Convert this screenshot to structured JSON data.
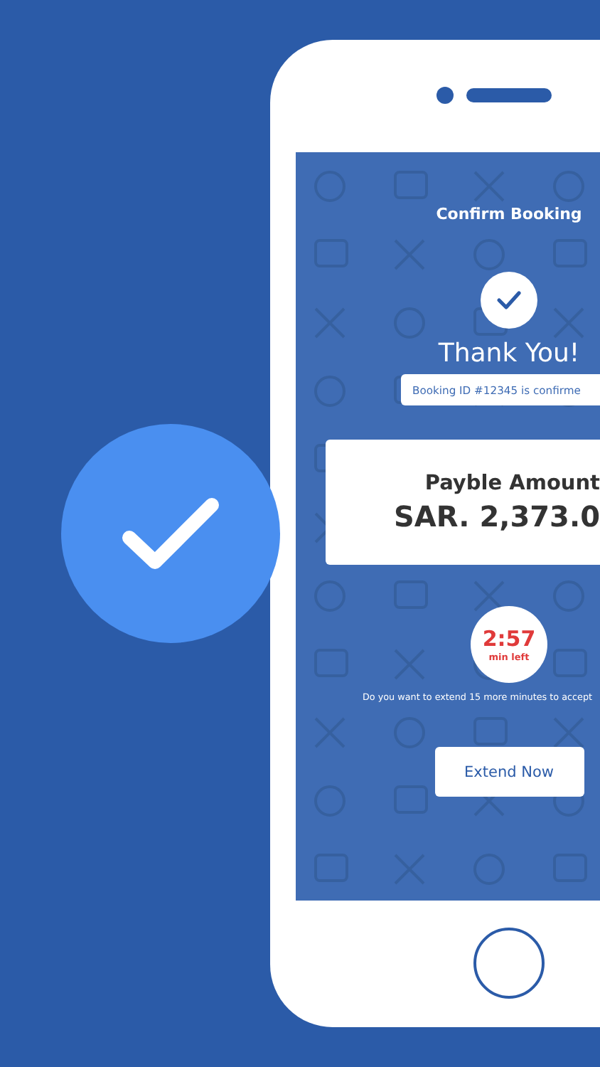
{
  "screen": {
    "title": "Confirm Booking",
    "heading": "Thank You!",
    "booking_message": "Booking ID #12345 is confirme",
    "amount": {
      "label": "Payble Amount",
      "value": "SAR. 2,373.0"
    },
    "timer": {
      "time": "2:57",
      "unit": "min left"
    },
    "extend_prompt": "Do you want to extend 15 more minutes to accept",
    "extend_button": "Extend Now"
  }
}
